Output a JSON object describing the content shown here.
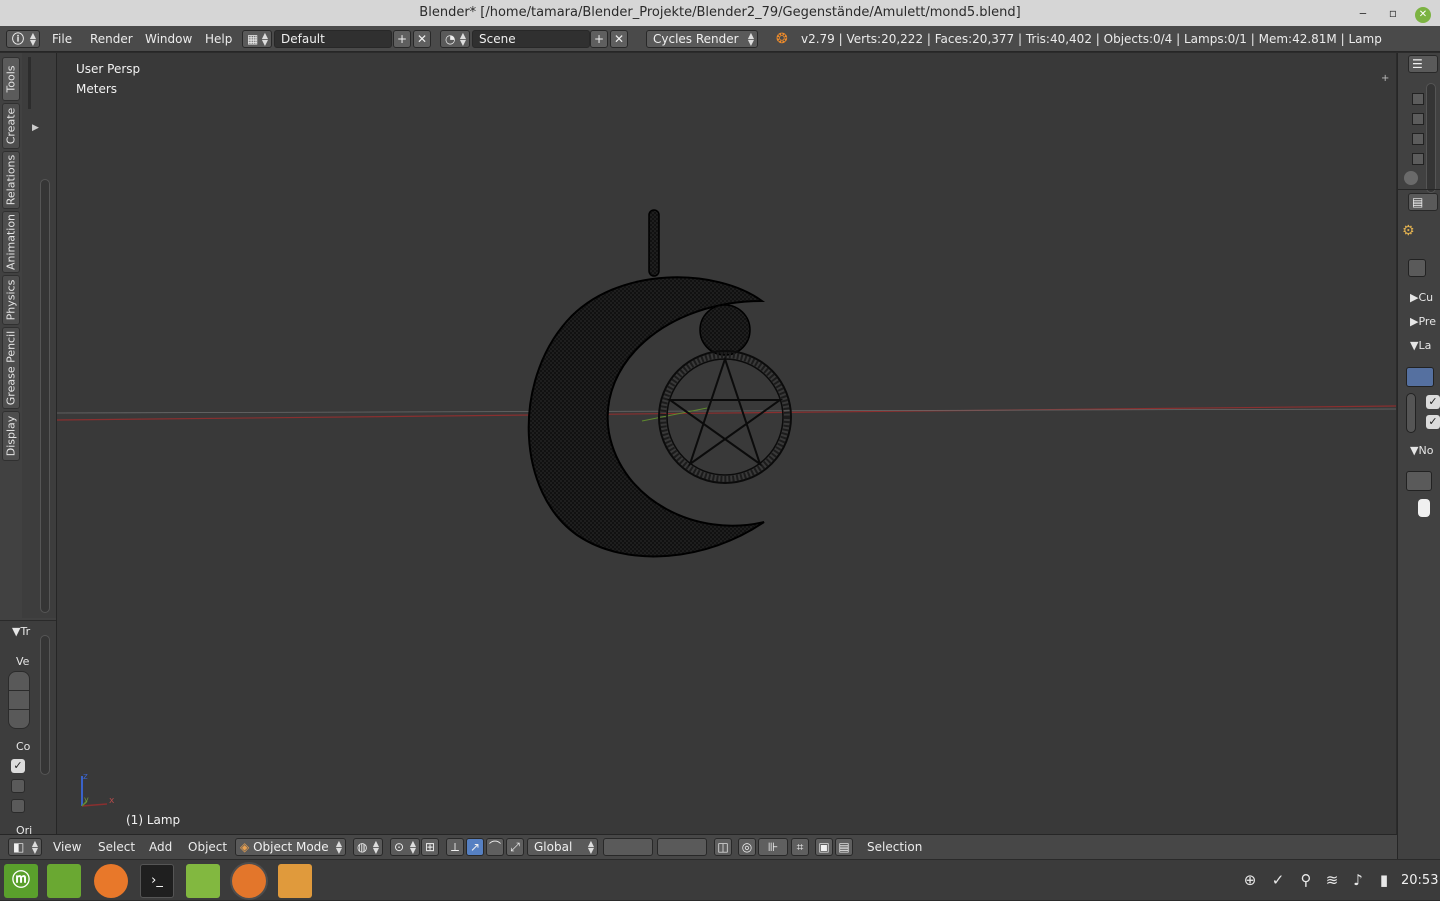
{
  "window": {
    "title": "Blender* [/home/tamara/Blender_Projekte/Blender2_79/Gegenstände/Amulett/mond5.blend]",
    "minimize_glyph": "‒",
    "restore_glyph": "▫",
    "close_glyph": "✕"
  },
  "info_header": {
    "menus": [
      "File",
      "Render",
      "Window",
      "Help"
    ],
    "layout_name": "Default",
    "scene_name": "Scene",
    "render_engine": "Cycles Render",
    "stats": "v2.79 | Verts:20,222 | Faces:20,377 | Tris:40,402 | Objects:0/4 | Lamps:0/1 | Mem:42.81M | Lamp"
  },
  "tool_shelf": {
    "tabs": [
      "Tools",
      "Create",
      "Relations",
      "Animation",
      "Physics",
      "Grease Pencil",
      "Display"
    ],
    "panel_title": "Tr",
    "view_label": "Ve",
    "color_label": "Co",
    "origin_label": "Ori"
  },
  "viewport": {
    "view_name": "User Persp",
    "units": "Meters",
    "active_object": "(1) Lamp",
    "axis_x": "x",
    "axis_y": "y",
    "axis_z": "z"
  },
  "properties": {
    "panel_labels": [
      "Cu",
      "Pre",
      "La",
      "No"
    ]
  },
  "view3d_header": {
    "menus": [
      "View",
      "Select",
      "Add",
      "Object"
    ],
    "mode": "Object Mode",
    "orientation": "Global",
    "status": "Selection"
  },
  "taskbar": {
    "clock": "20:53"
  },
  "colors": {
    "viewport_bg": "#393939",
    "x_axis": "#8a2f2f",
    "y_axis": "#5f8a2f",
    "z_axis": "#3a62c9",
    "mesh_wire": "#0b0b0b"
  }
}
